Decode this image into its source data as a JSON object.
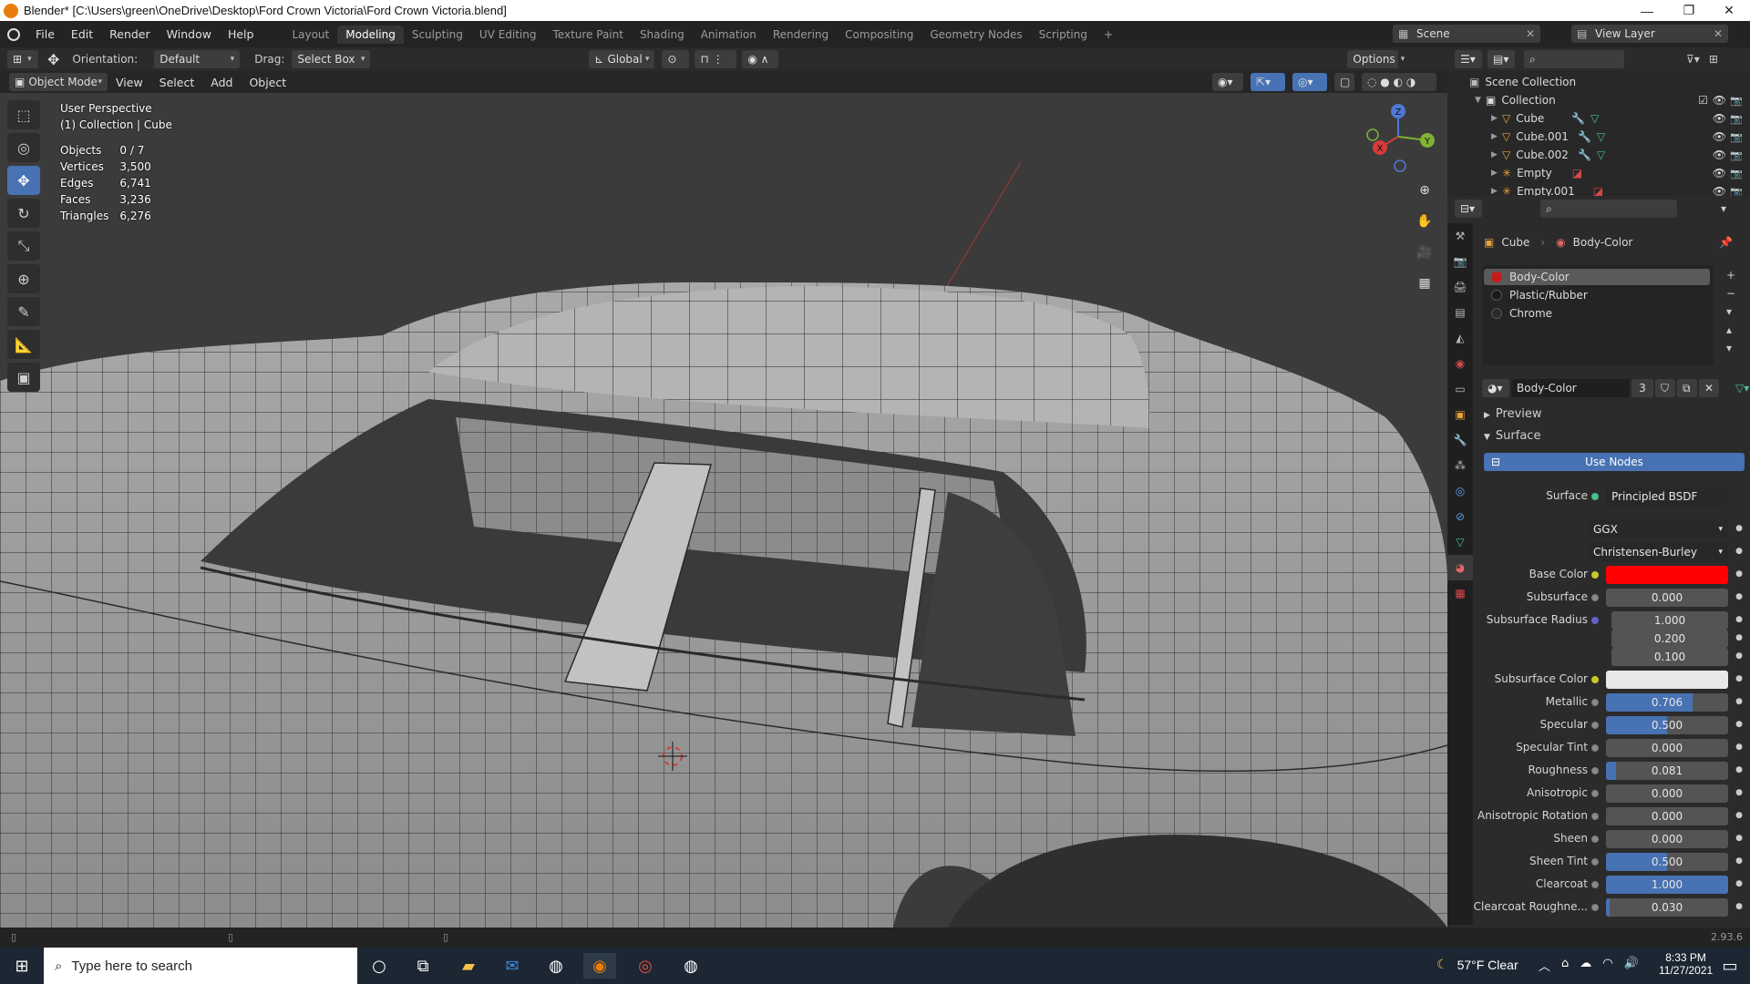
{
  "window": {
    "title": "Blender* [C:\\Users\\green\\OneDrive\\Desktop\\Ford Crown Victoria\\Ford Crown Victoria.blend]",
    "minimize": "—",
    "maximize": "❐",
    "close": "✕"
  },
  "menu": [
    "File",
    "Edit",
    "Render",
    "Window",
    "Help"
  ],
  "workspaces": [
    "Layout",
    "Modeling",
    "Sculpting",
    "UV Editing",
    "Texture Paint",
    "Shading",
    "Animation",
    "Rendering",
    "Compositing",
    "Geometry Nodes",
    "Scripting"
  ],
  "active_workspace": "Modeling",
  "scene": {
    "name": "Scene",
    "view_layer": "View Layer"
  },
  "tool_header": {
    "orientation_label": "Orientation:",
    "orientation_value": "Default",
    "drag_label": "Drag:",
    "drag_value": "Select Box",
    "transform_orientation": "Global",
    "options": "Options"
  },
  "viewport_header": {
    "mode": "Object Mode",
    "menus": [
      "View",
      "Select",
      "Add",
      "Object"
    ]
  },
  "viewport": {
    "perspective": "User Perspective",
    "collection": "(1) Collection | Cube",
    "stats": [
      {
        "label": "Objects",
        "value": "0 / 7"
      },
      {
        "label": "Vertices",
        "value": "3,500"
      },
      {
        "label": "Edges",
        "value": "6,741"
      },
      {
        "label": "Faces",
        "value": "3,236"
      },
      {
        "label": "Triangles",
        "value": "6,276"
      }
    ],
    "gizmo": {
      "x": "X",
      "y": "Y",
      "z": "Z"
    }
  },
  "outliner": {
    "root": "Scene Collection",
    "collection": "Collection",
    "items": [
      "Cube",
      "Cube.001",
      "Cube.002",
      "Empty",
      "Empty.001"
    ]
  },
  "properties": {
    "breadcrumb_object": "Cube",
    "breadcrumb_material": "Body-Color",
    "material_slots": [
      {
        "name": "Body-Color",
        "color": "#c41c1c"
      },
      {
        "name": "Plastic/Rubber",
        "color": "#1a1a1a"
      },
      {
        "name": "Chrome",
        "color": "#2a2a2a"
      }
    ],
    "material_name": "Body-Color",
    "material_users": "3",
    "section_preview": "Preview",
    "section_surface": "Surface",
    "use_nodes": "Use Nodes",
    "surface_label": "Surface",
    "surface_value": "Principled BSDF",
    "distribution": "GGX",
    "subsurface_method": "Christensen-Burley",
    "base_color_label": "Base Color",
    "base_color": "#ff0000",
    "subsurface_color_label": "Subsurface Color",
    "subsurface_color": "#e8e8e8",
    "rows": [
      {
        "label": "Subsurface",
        "value": "0.000",
        "fill": 0
      },
      {
        "label": "Metallic",
        "value": "0.706",
        "fill": 0.706
      },
      {
        "label": "Specular",
        "value": "0.500",
        "fill": 0.5
      },
      {
        "label": "Specular Tint",
        "value": "0.000",
        "fill": 0
      },
      {
        "label": "Roughness",
        "value": "0.081",
        "fill": 0.081
      },
      {
        "label": "Anisotropic",
        "value": "0.000",
        "fill": 0
      },
      {
        "label": "Anisotropic Rotation",
        "value": "0.000",
        "fill": 0
      },
      {
        "label": "Sheen",
        "value": "0.000",
        "fill": 0
      },
      {
        "label": "Sheen Tint",
        "value": "0.500",
        "fill": 0.5
      },
      {
        "label": "Clearcoat",
        "value": "1.000",
        "fill": 1
      },
      {
        "label": "Clearcoat Roughne...",
        "value": "0.030",
        "fill": 0.03
      }
    ],
    "subsurface_radius_label": "Subsurface Radius",
    "subsurface_radius": [
      "1.000",
      "0.200",
      "0.100"
    ]
  },
  "status": {
    "version": "2.93.6"
  },
  "taskbar": {
    "search_placeholder": "Type here to search",
    "weather": "57°F  Clear",
    "time": "8:33 PM",
    "date": "11/27/2021"
  }
}
